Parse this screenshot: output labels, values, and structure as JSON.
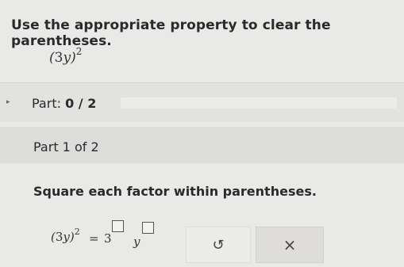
{
  "question": {
    "prompt": "Use the appropriate property to clear the parentheses.",
    "expression": {
      "open": "(",
      "coefficient": "3",
      "variable": "y",
      "close": ")",
      "exponent": "2"
    }
  },
  "part_header": {
    "label": "Part:",
    "progress_text": "0 / 2",
    "progress_fraction": 0
  },
  "part_one": {
    "label": "Part 1 of 2"
  },
  "task": {
    "instruction": "Square each factor within parentheses.",
    "equation": {
      "lhs_open": "(",
      "lhs_coefficient": "3",
      "lhs_variable": "y",
      "lhs_close": ")",
      "lhs_exponent": "2",
      "equals": "=",
      "base_number": "3",
      "base_variable": "y"
    }
  },
  "buttons": {
    "undo_icon": "undo-icon",
    "undo_glyph": "↺",
    "clear_icon": "close-icon",
    "clear_glyph": "×"
  }
}
